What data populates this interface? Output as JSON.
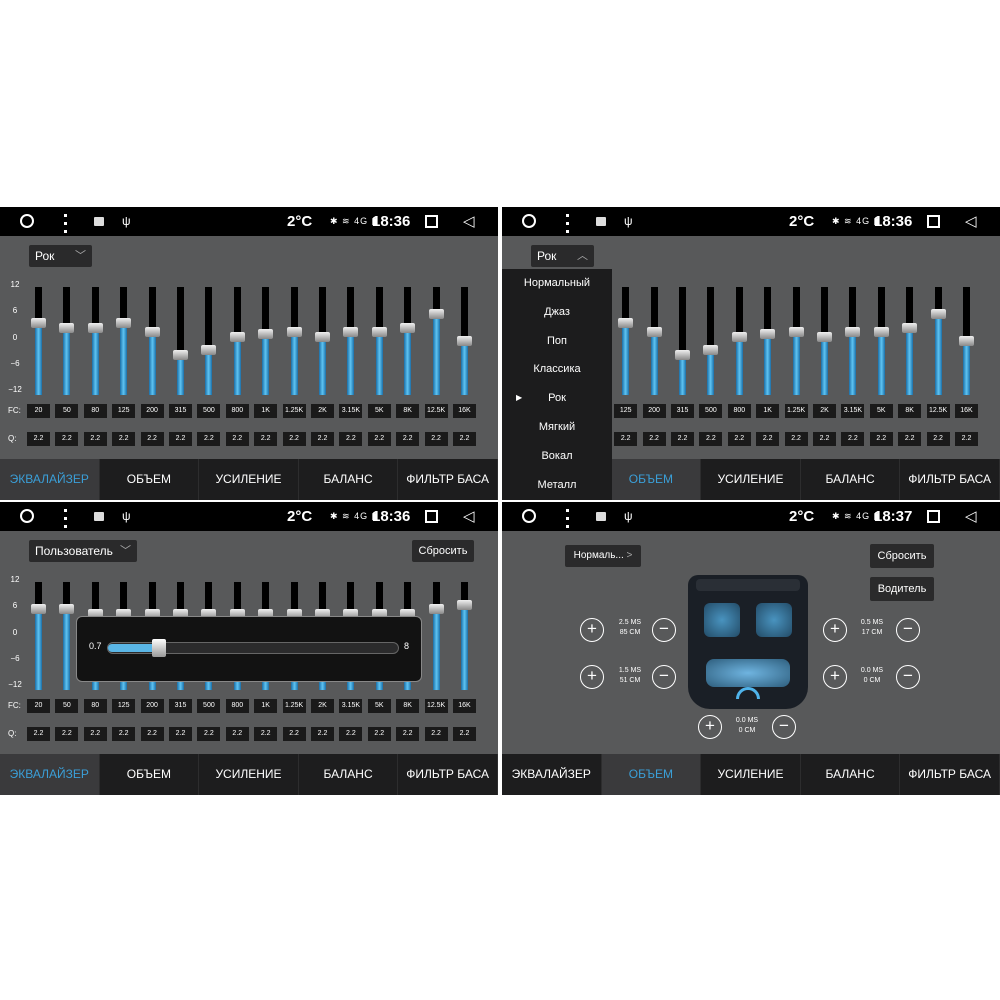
{
  "status": {
    "temp": "2°C",
    "icons": "✱ ≋ 4G ▮",
    "usb": "ψ"
  },
  "tabs": [
    "ЭКВАЛАЙЗЕР",
    "ОБЪЕМ",
    "УСИЛЕНИЕ",
    "БАЛАНС",
    "ФИЛЬТР БАСА"
  ],
  "eq": {
    "y_labels": [
      "12",
      "6",
      "0",
      "−6",
      "−12"
    ],
    "fc_label": "FC:",
    "q_label": "Q:",
    "frequencies": [
      "20",
      "50",
      "80",
      "125",
      "200",
      "315",
      "500",
      "800",
      "1K",
      "1.25K",
      "2K",
      "3.15K",
      "5K",
      "8K",
      "12.5K",
      "16K"
    ],
    "q_values": [
      "2.2",
      "2.2",
      "2.2",
      "2.2",
      "2.2",
      "2.2",
      "2.2",
      "2.2",
      "2.2",
      "2.2",
      "2.2",
      "2.2",
      "2.2",
      "2.2",
      "2.2",
      "2.2"
    ]
  },
  "panel1": {
    "time": "18:36",
    "preset": "Рок",
    "levels_db": [
      4,
      3,
      3,
      4,
      2,
      -3,
      -2,
      1,
      1.5,
      2,
      1,
      2,
      2,
      3,
      6,
      0
    ],
    "active_tab": 0
  },
  "panel2": {
    "time": "18:36",
    "preset": "Рок",
    "levels_db": [
      4,
      3,
      3,
      4,
      2,
      -3,
      -2,
      1,
      1.5,
      2,
      1,
      2,
      2,
      3,
      6,
      0
    ],
    "presets_menu": [
      "Нормальный",
      "Джаз",
      "Поп",
      "Классика",
      "Рок",
      "Мягкий",
      "Вокал",
      "Металл"
    ],
    "selected_preset_index": 4,
    "active_tab": 1
  },
  "panel3": {
    "time": "18:36",
    "preset": "Пользователь",
    "reset": "Сбросить",
    "levels_db": [
      6,
      6,
      5,
      5,
      5,
      5,
      5,
      5,
      5,
      5,
      5,
      5,
      5,
      5,
      6,
      7
    ],
    "q_popup": {
      "min": "0.7",
      "max": "8",
      "level": 0.17
    },
    "active_tab": 0
  },
  "panel4": {
    "time": "18:37",
    "mode": "Нормаль...",
    "reset": "Сбросить",
    "driver": "Водитель",
    "delays": {
      "front_left": {
        "ms": "2.5 MS",
        "cm": "85 CM"
      },
      "rear_left": {
        "ms": "1.5 MS",
        "cm": "51 CM"
      },
      "front_right": {
        "ms": "0.5 MS",
        "cm": "17 CM"
      },
      "rear_right": {
        "ms": "0.0 MS",
        "cm": "0 CM"
      },
      "sub": {
        "ms": "0.0 MS",
        "cm": "0 CM"
      }
    },
    "active_tab": 1
  }
}
